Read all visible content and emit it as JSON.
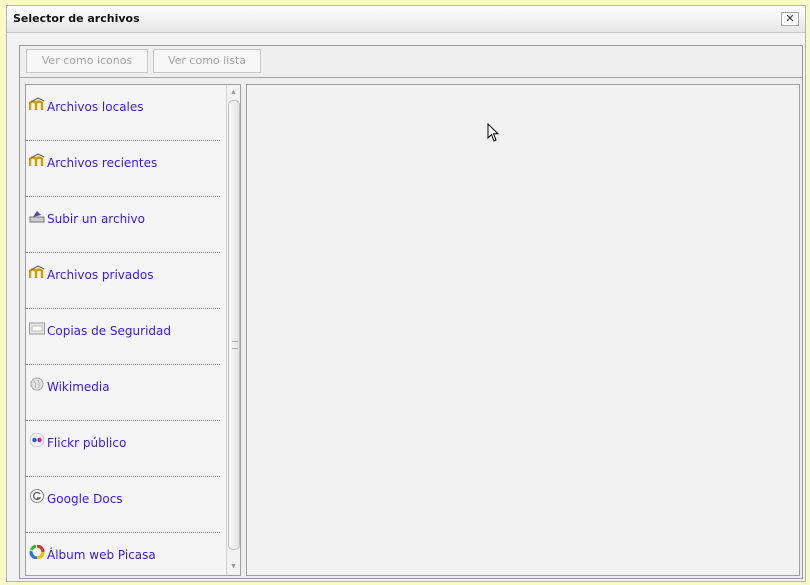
{
  "dialog": {
    "title": "Selector de archivos",
    "close_symbol": "✕"
  },
  "toolbar": {
    "view_icons_label": "Ver como iconos",
    "view_list_label": "Ver como lista"
  },
  "sidebar": {
    "items": [
      {
        "label": "Archivos locales",
        "icon": "moodle-icon"
      },
      {
        "label": "Archivos recientes",
        "icon": "moodle-icon"
      },
      {
        "label": "Subir un archivo",
        "icon": "upload-icon"
      },
      {
        "label": "Archivos privados",
        "icon": "moodle-icon"
      },
      {
        "label": "Copias de Seguridad",
        "icon": "backup-icon"
      },
      {
        "label": "Wikimedia",
        "icon": "wikimedia-icon"
      },
      {
        "label": "Flickr público",
        "icon": "flickr-icon"
      },
      {
        "label": "Google Docs",
        "icon": "google-icon"
      },
      {
        "label": "Álbum web Picasa",
        "icon": "picasa-icon"
      }
    ]
  },
  "colors": {
    "link": "#3a1ae0",
    "background": "#fafac8",
    "moodle_orange": "#e8a100"
  }
}
